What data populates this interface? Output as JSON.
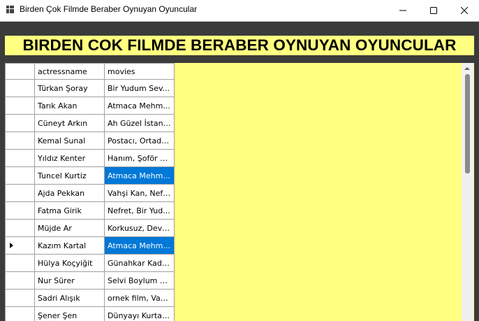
{
  "window": {
    "title": "Birden Çok Filmde Beraber Oynuyan Oyuncular",
    "minimize_glyph": "─",
    "maximize_glyph": "☐",
    "close_glyph": "✕"
  },
  "banner": {
    "text": "BIRDEN COK FILMDE BERABER OYNUYAN OYUNCULAR",
    "background": "#ffff80"
  },
  "grid": {
    "columns": [
      "actressname",
      "movies"
    ],
    "selected_row_index": 9,
    "rows": [
      {
        "actressname": "Türkan Şoray",
        "movies": "Bir Yudum Sev..."
      },
      {
        "actressname": "Tarık Akan",
        "movies": "Atmaca Mehm..."
      },
      {
        "actressname": "Cüneyt Arkın",
        "movies": "Ah Güzel İstanb..."
      },
      {
        "actressname": "Kemal Sunal",
        "movies": "Postacı, Ortadir..."
      },
      {
        "actressname": "Yıldız Kenter",
        "movies": "Hanım, Şoför D..."
      },
      {
        "actressname": "Tuncel Kurtiz",
        "movies": "Atmaca Mehm...",
        "movies_selected": true
      },
      {
        "actressname": "Ajda Pekkan",
        "movies": "Vahşi Kan, Nefr..."
      },
      {
        "actressname": "Fatma Girik",
        "movies": "Nefret, Bir Yud..."
      },
      {
        "actressname": "Müjde Ar",
        "movies": "Korkusuz, Devle..."
      },
      {
        "actressname": "Kazım Kartal",
        "movies": "Atmaca Mehm...",
        "movies_selected": true
      },
      {
        "actressname": "Hülya Koçyiğit",
        "movies": "Günahkar Kadı..."
      },
      {
        "actressname": "Nur Sürer",
        "movies": "Selvi Boylum Al..."
      },
      {
        "actressname": "Sadri Alışık",
        "movies": "ornek film, Vah..."
      },
      {
        "actressname": "Şener Şen",
        "movies": "Dünyayı Kurtar..."
      }
    ],
    "selection_color": "#0078d7"
  }
}
